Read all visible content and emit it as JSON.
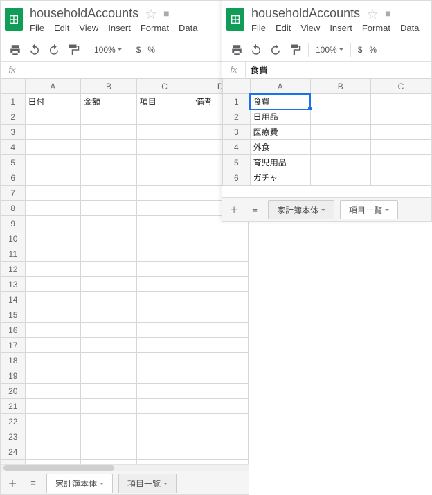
{
  "left": {
    "title": "householdAccounts",
    "menus": [
      "File",
      "Edit",
      "View",
      "Insert",
      "Format",
      "Data"
    ],
    "zoom": "100%",
    "currency": "$",
    "percent": "%",
    "fx": "",
    "cols": [
      "A",
      "B",
      "C",
      "D"
    ],
    "rows_shown": 25,
    "bordered_rows": 22,
    "headers": [
      "日付",
      "金額",
      "項目",
      "備考"
    ],
    "selected_row": 13,
    "tabs": [
      {
        "label": "家計簿本体",
        "active": true
      },
      {
        "label": "項目一覧",
        "active": false
      }
    ]
  },
  "right": {
    "title": "householdAccounts",
    "menus": [
      "File",
      "Edit",
      "View",
      "Insert",
      "Format",
      "Data"
    ],
    "zoom": "100%",
    "currency": "$",
    "percent": "%",
    "fx": "食費",
    "cols": [
      "A",
      "B",
      "C"
    ],
    "rows": [
      "食費",
      "日用品",
      "医療費",
      "外食",
      "育児用品",
      "ガチャ"
    ],
    "selected": {
      "row": 1,
      "col": "A"
    },
    "tabs": [
      {
        "label": "家計簿本体",
        "active": false
      },
      {
        "label": "項目一覧",
        "active": true
      }
    ]
  }
}
